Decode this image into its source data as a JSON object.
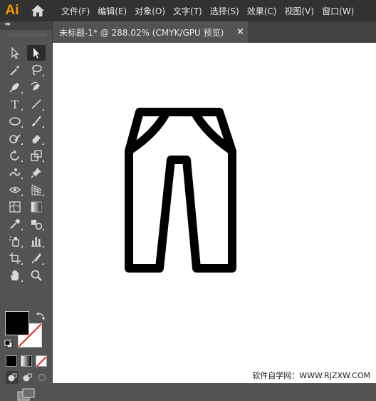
{
  "app": {
    "logo": "Ai",
    "home_icon": "home-icon"
  },
  "menu": [
    {
      "label": "文件(F)"
    },
    {
      "label": "编辑(E)"
    },
    {
      "label": "对象(O)"
    },
    {
      "label": "文字(T)"
    },
    {
      "label": "选择(S)"
    },
    {
      "label": "效果(C)"
    },
    {
      "label": "视图(V)"
    },
    {
      "label": "窗口(W)"
    }
  ],
  "toolbar": {
    "collapse_label": "◂◂",
    "tools": [
      "selection-tool",
      "direct-selection-tool",
      "magic-wand-tool",
      "lasso-tool",
      "pen-tool",
      "curvature-tool",
      "type-tool",
      "line-segment-tool",
      "ellipse-tool",
      "paintbrush-tool",
      "shaper-tool",
      "eraser-tool",
      "rotate-tool",
      "scale-tool",
      "puppet-warp-tool",
      "pin-tool",
      "free-transform-tool",
      "perspective-grid-tool",
      "mesh-tool",
      "gradient-tool",
      "eyedropper-tool",
      "blend-tool",
      "symbol-sprayer-tool",
      "column-graph-tool",
      "artboard-tool",
      "slice-tool",
      "hand-tool",
      "zoom-tool"
    ],
    "selected_tool": "direct-selection-tool",
    "type_tool_glyph": "T",
    "fill_color": "#000000",
    "stroke_color": "none"
  },
  "document": {
    "tab_title": "未标题-1* @ 288.02% (CMYK/GPU 预览)",
    "close_glyph": "×",
    "zoom": "288.02%",
    "color_mode": "CMYK/GPU 预览"
  },
  "canvas": {
    "background": "#ffffff",
    "artwork": "pants-icon",
    "watermark": "软件自学网：WWW.RJZXW.COM"
  },
  "colors": {
    "accent_logo": "#ff9a00",
    "menubar_bg": "#323232",
    "panel_bg": "#535353"
  }
}
